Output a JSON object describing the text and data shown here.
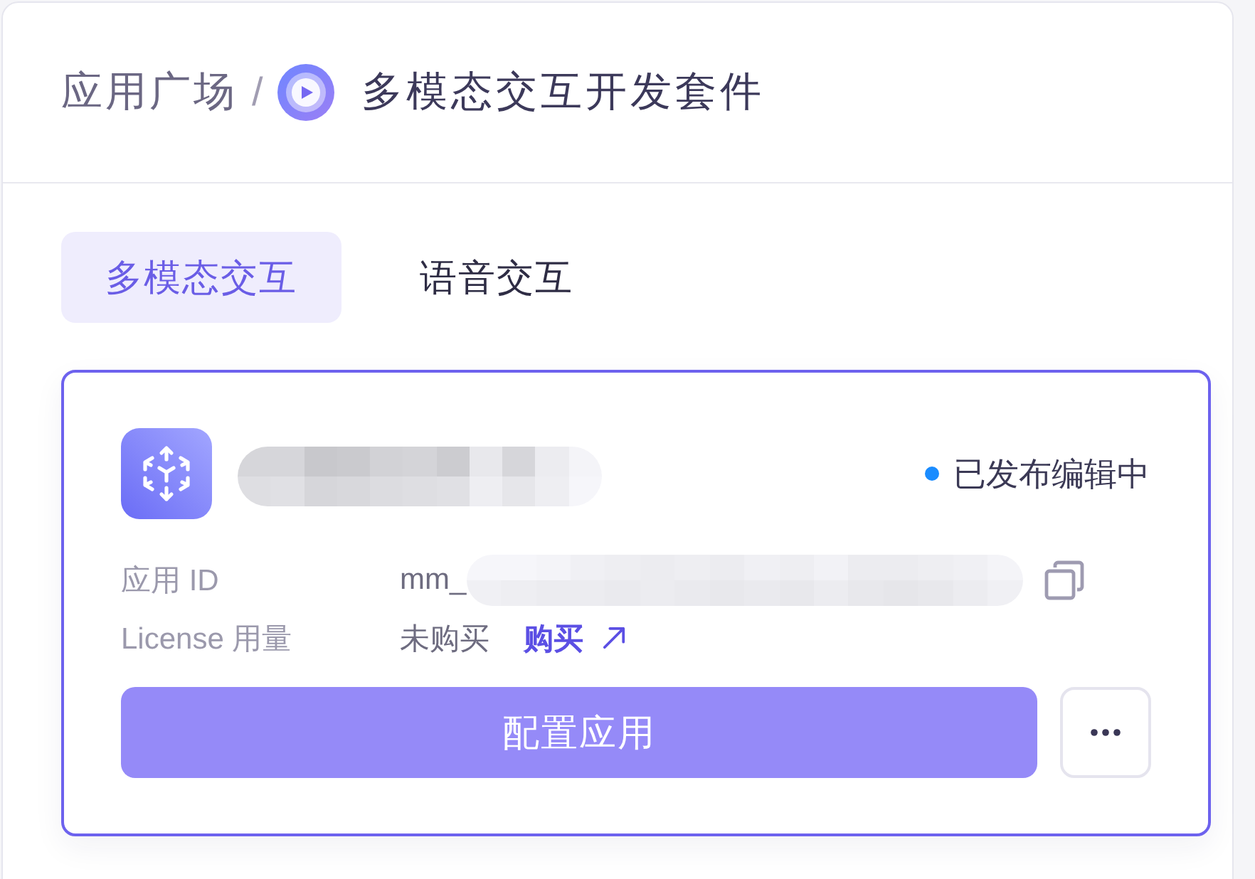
{
  "breadcrumb": {
    "parent": "应用广场",
    "separator": "/",
    "current": "多模态交互开发套件"
  },
  "tabs": [
    {
      "label": "多模态交互",
      "selected": true
    },
    {
      "label": "语音交互",
      "selected": false
    }
  ],
  "app_card": {
    "selected": true,
    "status": "已发布编辑中",
    "fields": [
      {
        "kind": "id",
        "label": "应用 ID",
        "value": "mm_"
      },
      {
        "kind": "license",
        "label": "License 用量",
        "value": "未购买",
        "link": "购买"
      }
    ],
    "primary_button": "配置应用"
  }
}
